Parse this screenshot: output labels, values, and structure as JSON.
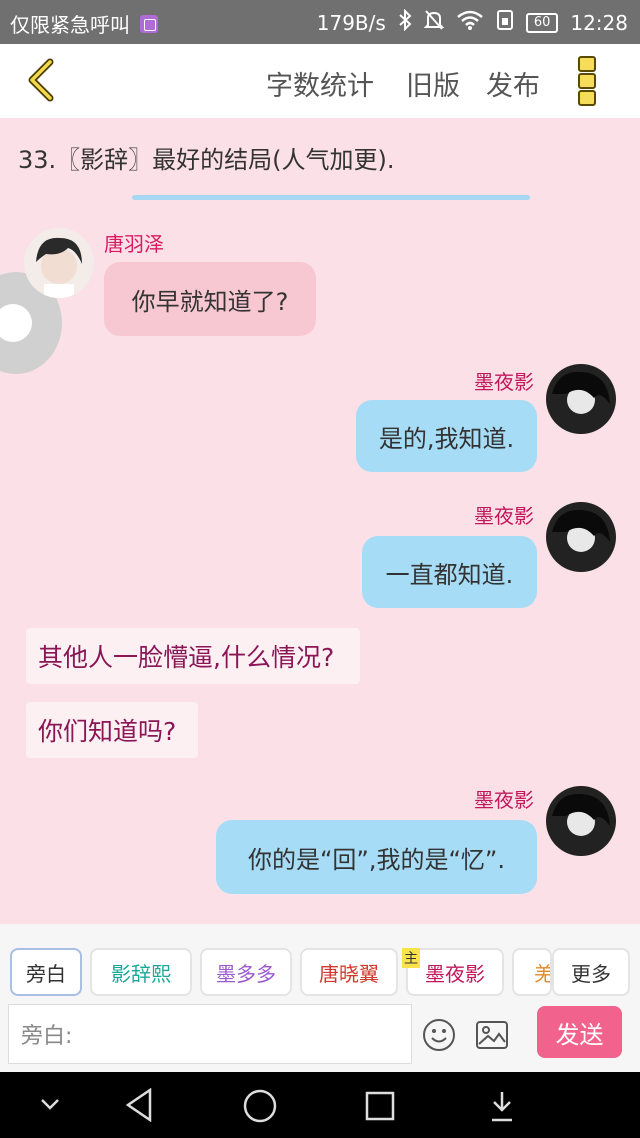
{
  "status_bar": {
    "carrier_text": "仅限紧急呼叫",
    "net_speed": "179B/s",
    "battery": "60",
    "time": "12:28",
    "icons": [
      "image-icon",
      "bluetooth-icon",
      "mute-icon",
      "wifi-icon",
      "sim-icon",
      "battery-icon"
    ]
  },
  "top_bar": {
    "back_icon": "chevron-left-icon",
    "word_count": "字数统计",
    "old_version": "旧版",
    "publish": "发布",
    "menu_icon": "menu-icon"
  },
  "chapter_title": "33.〖影辞〗最好的结局(人气加更).",
  "messages": [
    {
      "speaker": "唐羽泽",
      "text": "你早就知道了?"
    },
    {
      "speaker": "墨夜影",
      "text": "是的,我知道."
    },
    {
      "speaker": "墨夜影",
      "text": "一直都知道."
    },
    {
      "narration": "其他人一脸懵逼,什么情况?"
    },
    {
      "narration": "你们知道吗?"
    },
    {
      "speaker": "墨夜影",
      "text": "你的是“回”,我的是“忆”."
    }
  ],
  "character_chips": [
    {
      "label": "旁白",
      "color": "#333333"
    },
    {
      "label": "影辞熙",
      "color": "#1aa89a"
    },
    {
      "label": "墨多多",
      "color": "#9b59d0"
    },
    {
      "label": "唐晓翼",
      "color": "#d0392b"
    },
    {
      "label": "墨夜影",
      "color": "#c2185b",
      "badge": "主"
    },
    {
      "label": "羌",
      "color": "#e08a2a"
    }
  ],
  "more_button": "更多",
  "input": {
    "placeholder": "旁白:"
  },
  "emoji_icon": "emoji-icon",
  "image_icon": "image-icon",
  "send_button": "发送",
  "nav_icons": [
    "chevron-down-icon",
    "back-triangle-icon",
    "home-circle-icon",
    "recents-square-icon",
    "download-icon"
  ],
  "colors": {
    "background": "#fbe1e7",
    "bubble_blue": "#a7dcf6",
    "bubble_pink": "#f8c8d2",
    "send": "#f1638c"
  }
}
